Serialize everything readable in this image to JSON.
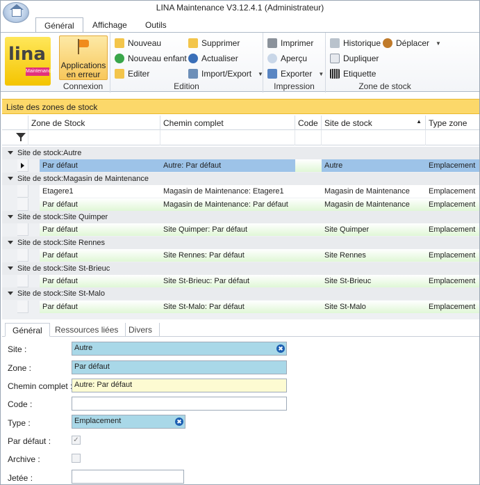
{
  "window": {
    "title": "LINA Maintenance  V3.12.4.1  (Administrateur)"
  },
  "ribbon_tabs": [
    "Général",
    "Affichage",
    "Outils"
  ],
  "logo": {
    "text": "lina",
    "sub": "Maintenance"
  },
  "connexion": {
    "button_label": "Applications en erreur",
    "group_label": "Connexion"
  },
  "edition": {
    "group_label": "Edition",
    "buttons": [
      "Nouveau",
      "Nouveau enfant",
      "Editer",
      "Supprimer",
      "Actualiser",
      "Import/Export"
    ]
  },
  "impression": {
    "group_label": "Impression",
    "buttons": [
      "Imprimer",
      "Aperçu",
      "Exporter"
    ]
  },
  "zone_stock": {
    "group_label": "Zone de stock",
    "buttons": [
      "Historique",
      "Déplacer",
      "Dupliquer",
      "Etiquette"
    ]
  },
  "grid": {
    "title": "Liste des zones de stock",
    "columns": [
      "Zone de Stock",
      "Chemin complet",
      "Code",
      "Site de stock",
      "Type zone"
    ],
    "groups": [
      {
        "label": "Site de stock:Autre",
        "rows": [
          {
            "zone": "Par défaut",
            "chemin": "Autre: Par défaut",
            "code": "",
            "site": "Autre",
            "type": "Emplacement",
            "style": "current"
          }
        ]
      },
      {
        "label": "Site de stock:Magasin de Maintenance",
        "rows": [
          {
            "zone": "Etagere1",
            "chemin": "Magasin de Maintenance: Etagere1",
            "code": "",
            "site": "Magasin de Maintenance",
            "type": "Emplacement",
            "style": "white"
          },
          {
            "zone": "Par défaut",
            "chemin": "Magasin de Maintenance: Par défaut",
            "code": "",
            "site": "Magasin de Maintenance",
            "type": "Emplacement",
            "style": "green"
          }
        ]
      },
      {
        "label": "Site de stock:Site Quimper",
        "rows": [
          {
            "zone": "Par défaut",
            "chemin": "Site Quimper: Par défaut",
            "code": "",
            "site": "Site Quimper",
            "type": "Emplacement",
            "style": "green"
          }
        ]
      },
      {
        "label": "Site de stock:Site Rennes",
        "rows": [
          {
            "zone": "Par défaut",
            "chemin": "Site Rennes: Par défaut",
            "code": "",
            "site": "Site Rennes",
            "type": "Emplacement",
            "style": "green"
          }
        ]
      },
      {
        "label": "Site de stock:Site St-Brieuc",
        "rows": [
          {
            "zone": "Par défaut",
            "chemin": "Site St-Brieuc: Par défaut",
            "code": "",
            "site": "Site St-Brieuc",
            "type": "Emplacement",
            "style": "green"
          }
        ]
      },
      {
        "label": "Site de stock:Site St-Malo",
        "rows": [
          {
            "zone": "Par défaut",
            "chemin": "Site St-Malo: Par défaut",
            "code": "",
            "site": "Site St-Malo",
            "type": "Emplacement",
            "style": "green"
          }
        ]
      }
    ]
  },
  "detail_tabs": [
    "Général",
    "Ressources liées",
    "Divers"
  ],
  "form": {
    "site_label": "Site :",
    "site_value": "Autre",
    "zone_label": "Zone :",
    "zone_value": "Par défaut",
    "chemin_label": "Chemin complet :",
    "chemin_value": "Autre: Par défaut",
    "code_label": "Code :",
    "code_value": "",
    "type_label": "Type :",
    "type_value": "Emplacement",
    "par_defaut_label": "Par défaut :",
    "par_defaut_checked": true,
    "archive_label": "Archive :",
    "archive_checked": false,
    "jetee_label": "Jetée :",
    "jetee_value": ""
  }
}
